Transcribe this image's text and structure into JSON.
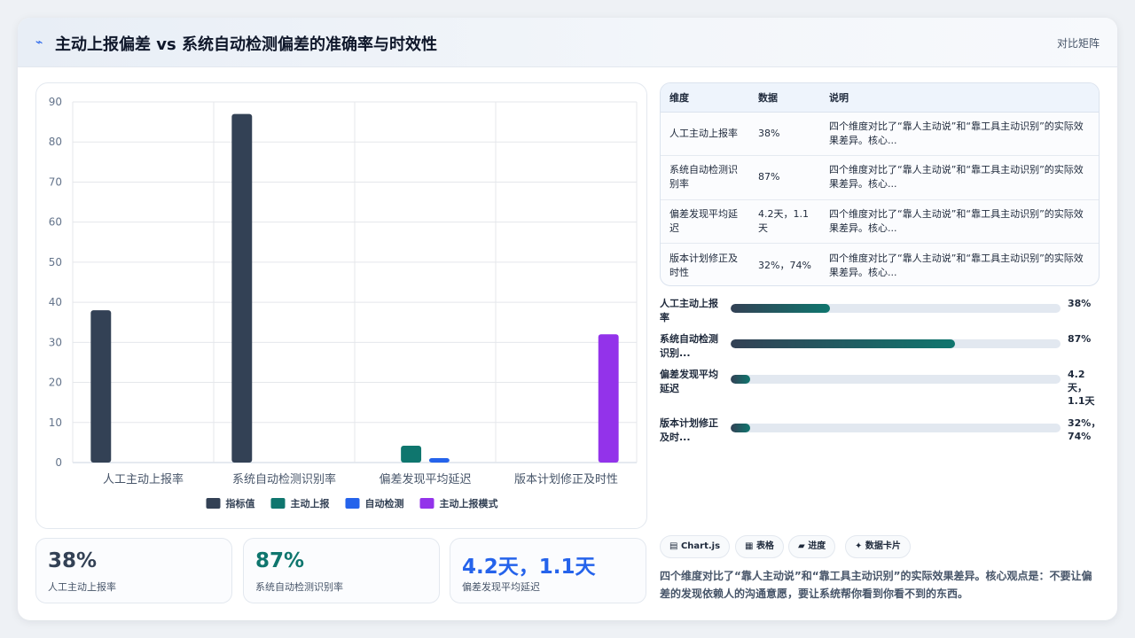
{
  "header": {
    "icon": "pulse-icon",
    "title": "主动上报偏差 vs 系统自动检测偏差的准确率与时效性",
    "tag": "对比矩阵"
  },
  "chart_data": {
    "type": "bar",
    "categories": [
      "人工主动上报率",
      "系统自动检测识别率",
      "偏差发现平均延迟",
      "版本计划修正及时性"
    ],
    "ylim": [
      0,
      90
    ],
    "yticks": [
      0,
      10,
      20,
      30,
      40,
      50,
      60,
      70,
      80,
      90
    ],
    "grid": true,
    "legend_position": "bottom",
    "series": [
      {
        "name": "指标值",
        "color": "#334155",
        "values": [
          38,
          87,
          null,
          null
        ]
      },
      {
        "name": "主动上报",
        "color": "#0f766e",
        "values": [
          null,
          null,
          4.2,
          null
        ]
      },
      {
        "name": "自动检测",
        "color": "#2563eb",
        "values": [
          null,
          null,
          1.1,
          null
        ]
      },
      {
        "name": "主动上报模式",
        "color": "#9333ea",
        "values": [
          null,
          null,
          null,
          32
        ]
      }
    ]
  },
  "stats": [
    {
      "value": "38%",
      "label": "人工主动上报率",
      "color": "#334155"
    },
    {
      "value": "87%",
      "label": "系统自动检测识别率",
      "color": "#0f766e"
    },
    {
      "value": "4.2天，1.1天",
      "label": "偏差发现平均延迟",
      "color": "#2563eb"
    }
  ],
  "table": {
    "headers": [
      "维度",
      "数据",
      "说明"
    ],
    "rows": [
      [
        "人工主动上报率",
        "38%",
        "四个维度对比了“靠人主动说”和“靠工具主动识别”的实际效果差异。核心..."
      ],
      [
        "系统自动检测识别率",
        "87%",
        "四个维度对比了“靠人主动说”和“靠工具主动识别”的实际效果差异。核心..."
      ],
      [
        "偏差发现平均延迟",
        "4.2天，1.1天",
        "四个维度对比了“靠人主动说”和“靠工具主动识别”的实际效果差异。核心..."
      ],
      [
        "版本计划修正及时性",
        "32%，74%",
        "四个维度对比了“靠人主动说”和“靠工具主动识别”的实际效果差异。核心..."
      ]
    ]
  },
  "progress": [
    {
      "label": "人工主动上报率",
      "value_text": "38%",
      "fraction": 0.3
    },
    {
      "label": "系统自动检测识别...",
      "value_text": "87%",
      "fraction": 0.68
    },
    {
      "label": "偏差发现平均延迟",
      "value_text": "4.2天，1.1天",
      "fraction": 0.06
    },
    {
      "label": "版本计划修正及时...",
      "value_text": "32%，74%",
      "fraction": 0.06
    }
  ],
  "chips": [
    {
      "icon": "chart-icon",
      "glyph": "▤",
      "label": "Chart.js"
    },
    {
      "icon": "table-icon",
      "glyph": "▦",
      "label": "表格"
    },
    {
      "icon": "progress-icon",
      "glyph": "▰",
      "label": "进度"
    },
    {
      "icon": "sparkle-icon",
      "glyph": "✦",
      "label": "数据卡片"
    }
  ],
  "summary": "四个维度对比了“靠人主动说”和“靠工具主动识别”的实际效果差异。核心观点是：不要让偏差的发现依赖人的沟通意愿，要让系统帮你看到你看不到的东西。"
}
